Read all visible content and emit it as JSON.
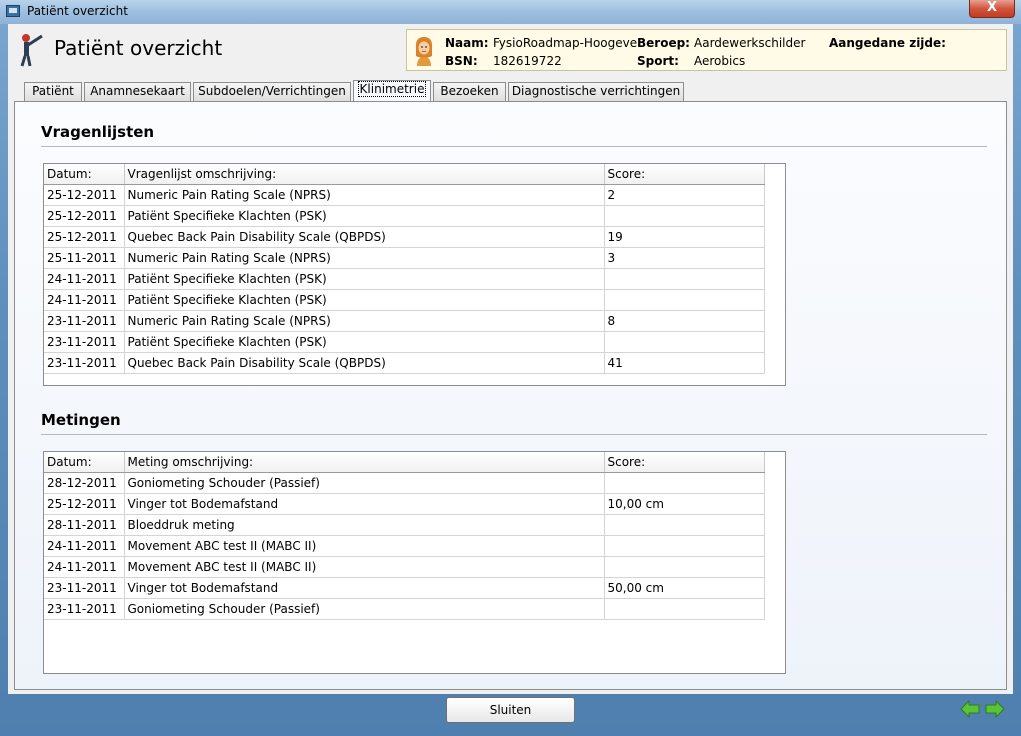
{
  "window": {
    "title": "Patiënt overzicht",
    "close_label": "X"
  },
  "header": {
    "title": "Patiënt overzicht"
  },
  "patient": {
    "naam_label": "Naam:",
    "naam": "FysioRoadmap-Hoogeve",
    "bsn_label": "BSN:",
    "bsn": "182619722",
    "beroep_label": "Beroep:",
    "beroep": "Aardewerkschilder",
    "sport_label": "Sport:",
    "sport": "Aerobics",
    "zijde_label": "Aangedane zijde:"
  },
  "tabs": [
    {
      "label": "Patiënt"
    },
    {
      "label": "Anamnesekaart"
    },
    {
      "label": "Subdoelen/Verrichtingen"
    },
    {
      "label": "Klinimetrie"
    },
    {
      "label": "Bezoeken"
    },
    {
      "label": "Diagnostische verrichtingen"
    }
  ],
  "vragenlijsten": {
    "title": "Vragenlijsten",
    "headers": [
      "Datum:",
      "Vragenlijst omschrijving:",
      "Score:"
    ],
    "rows": [
      [
        "25-12-2011",
        "Numeric Pain Rating Scale (NPRS)",
        "2"
      ],
      [
        "25-12-2011",
        "Patiënt Specifieke Klachten (PSK)",
        ""
      ],
      [
        "25-12-2011",
        "Quebec Back Pain Disability Scale (QBPDS)",
        "19"
      ],
      [
        "25-11-2011",
        "Numeric Pain Rating Scale (NPRS)",
        "3"
      ],
      [
        "24-11-2011",
        "Patiënt Specifieke Klachten (PSK)",
        ""
      ],
      [
        "24-11-2011",
        "Patiënt Specifieke Klachten (PSK)",
        ""
      ],
      [
        "23-11-2011",
        "Numeric Pain Rating Scale (NPRS)",
        "8"
      ],
      [
        "23-11-2011",
        "Patiënt Specifieke Klachten (PSK)",
        ""
      ],
      [
        "23-11-2011",
        "Quebec Back Pain Disability Scale (QBPDS)",
        "41"
      ]
    ]
  },
  "metingen": {
    "title": "Metingen",
    "headers": [
      "Datum:",
      "Meting omschrijving:",
      "Score:"
    ],
    "rows": [
      [
        "28-12-2011",
        "Goniometing Schouder (Passief)",
        ""
      ],
      [
        "25-12-2011",
        "Vinger tot Bodemafstand",
        "10,00 cm"
      ],
      [
        "28-11-2011",
        "Bloeddruk meting",
        ""
      ],
      [
        "24-11-2011",
        "Movement ABC test II (MABC II)",
        ""
      ],
      [
        "24-11-2011",
        "Movement ABC test II (MABC II)",
        ""
      ],
      [
        "23-11-2011",
        "Vinger tot Bodemafstand",
        "50,00 cm"
      ],
      [
        "23-11-2011",
        "Goniometing Schouder (Passief)",
        ""
      ]
    ]
  },
  "footer": {
    "close_label": "Sluiten"
  },
  "icons": {
    "prev": "arrow-left-icon",
    "next": "arrow-right-icon"
  },
  "colors": {
    "accent_green": "#5cc23a",
    "card_bg": "#fffbe6"
  }
}
